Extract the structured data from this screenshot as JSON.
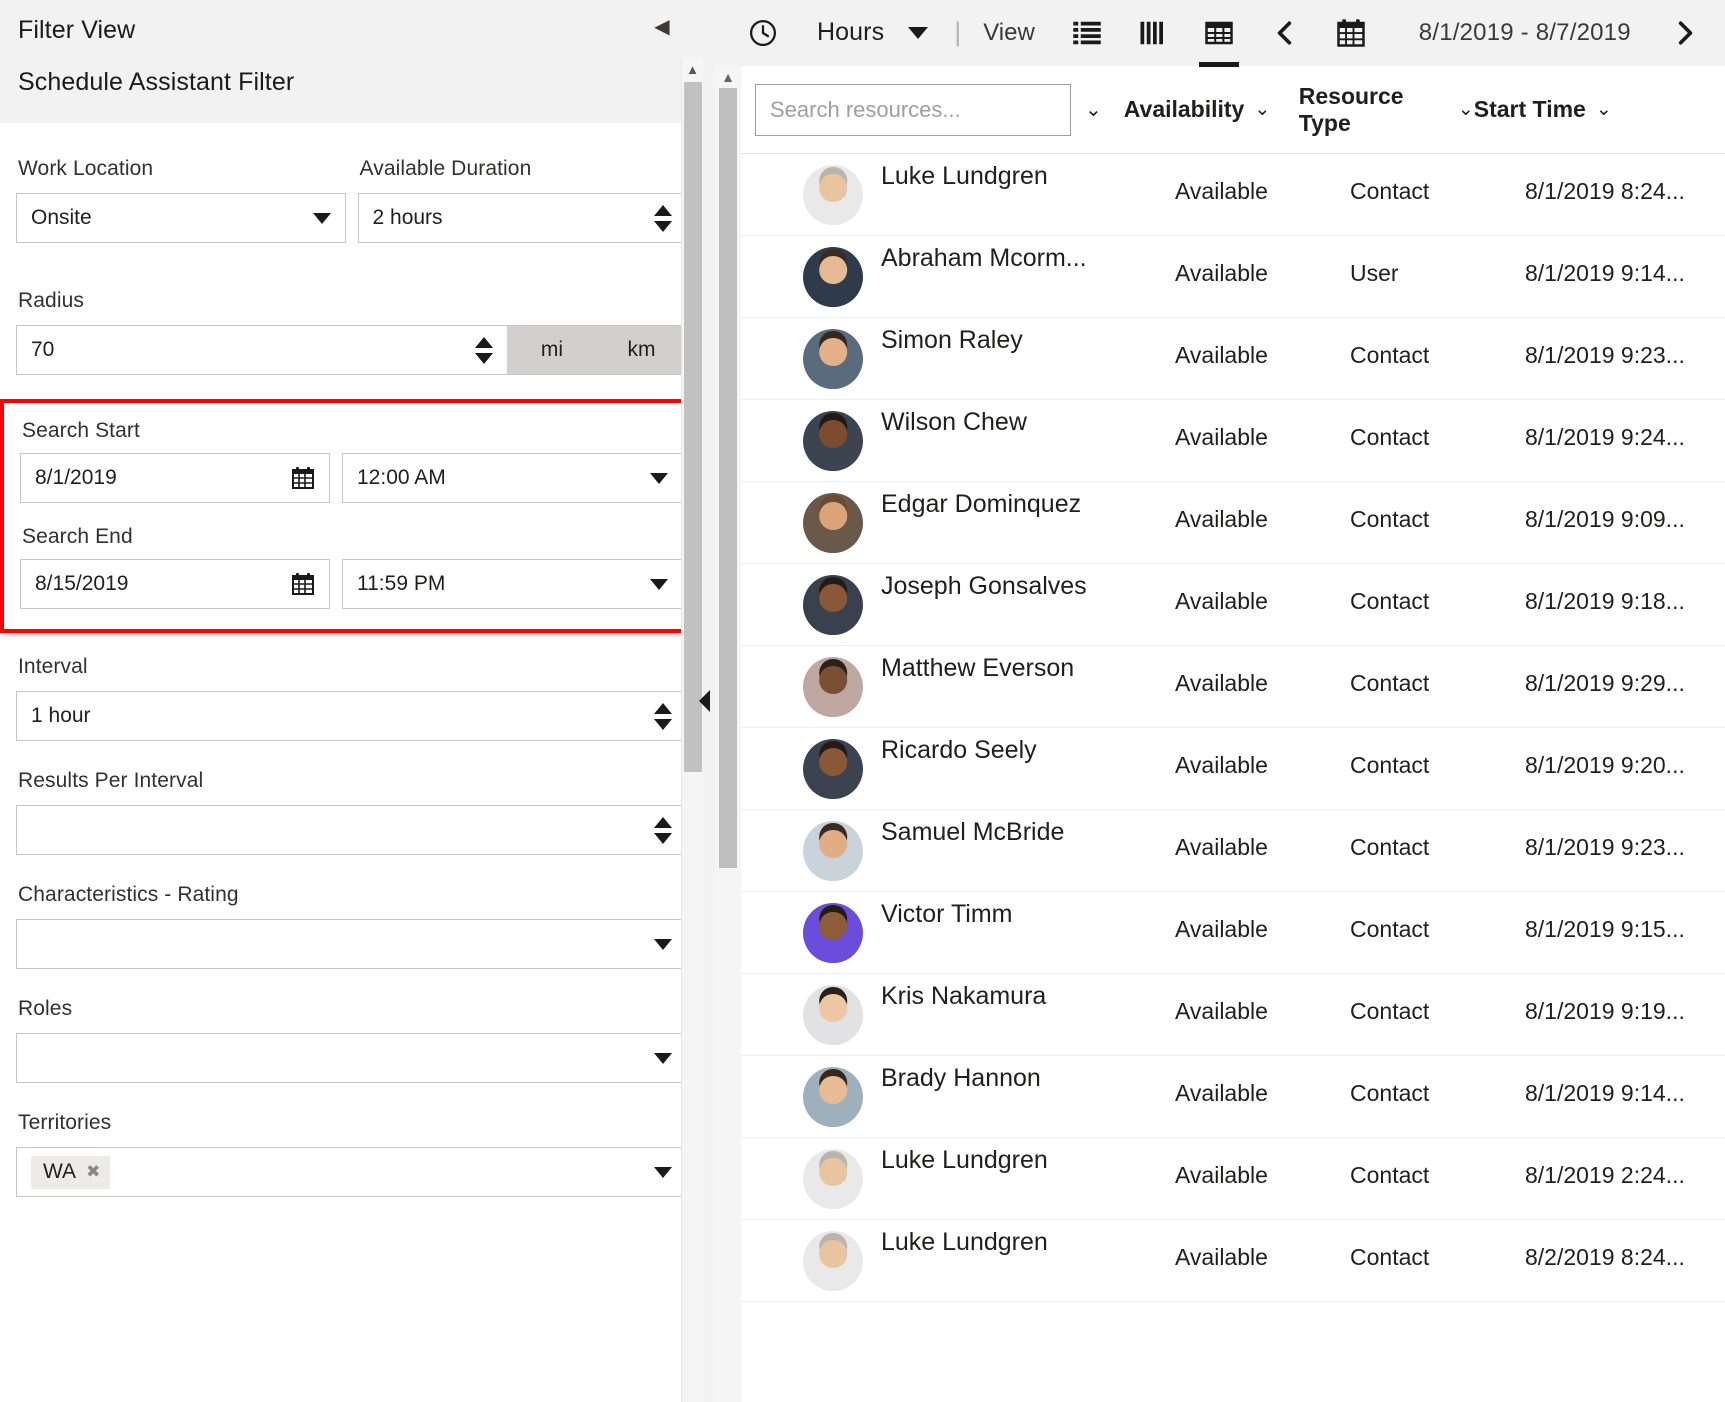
{
  "left_panel": {
    "title": "Filter View",
    "subtitle": "Schedule Assistant Filter",
    "collapse_icon": "chevron-left-icon",
    "fields": {
      "work_location": {
        "label": "Work Location",
        "value": "Onsite"
      },
      "available_duration": {
        "label": "Available Duration",
        "value": "2 hours"
      },
      "radius": {
        "label": "Radius",
        "value": "70",
        "unit_mi": "mi",
        "unit_km": "km"
      },
      "search_start": {
        "label": "Search Start",
        "date": "8/1/2019",
        "time": "12:00 AM"
      },
      "search_end": {
        "label": "Search End",
        "date": "8/15/2019",
        "time": "11:59 PM"
      },
      "interval": {
        "label": "Interval",
        "value": "1 hour"
      },
      "results_per_interval": {
        "label": "Results Per Interval",
        "value": ""
      },
      "characteristics_rating": {
        "label": "Characteristics - Rating",
        "value": ""
      },
      "roles": {
        "label": "Roles",
        "value": ""
      },
      "territories": {
        "label": "Territories",
        "tags": [
          "WA"
        ]
      }
    },
    "highlight_color": "#ff0000"
  },
  "right_panel": {
    "toolbar": {
      "clock_icon": "clock-icon",
      "unit_label": "Hours",
      "unit_caret_icon": "chevron-down-icon",
      "separator": "|",
      "view_label": "View",
      "icons": [
        {
          "name": "list-view-icon",
          "active": false
        },
        {
          "name": "column-view-icon",
          "active": false
        },
        {
          "name": "grid-view-icon",
          "active": true
        }
      ],
      "prev_icon": "chevron-left-icon",
      "calendar_icon": "calendar-icon",
      "date_range": "8/1/2019 - 8/7/2019",
      "next_icon": "chevron-right-icon"
    },
    "grid": {
      "search_placeholder": "Search resources...",
      "search_value": "",
      "search_chevron_icon": "chevron-down-icon",
      "columns": [
        {
          "label": "Availability",
          "sort_icon": "chevron-down-icon"
        },
        {
          "label": "Resource Type",
          "sort_icon": "chevron-down-icon"
        },
        {
          "label": "Start Time",
          "sort_icon": "chevron-down-icon"
        }
      ],
      "rows": [
        {
          "name": "Luke Lundgren",
          "availability": "Available",
          "resource_type": "Contact",
          "start_time": "8/1/2019 8:24...",
          "skin": "#e8c4a0",
          "hair": "#b9b5ad",
          "shirt": "#e9e9ea"
        },
        {
          "name": "Abraham Mcorm...",
          "availability": "Available",
          "resource_type": "User",
          "start_time": "8/1/2019 9:14...",
          "skin": "#e6b894",
          "hair": "#3a2b20",
          "shirt": "#2f3a4a"
        },
        {
          "name": "Simon Raley",
          "availability": "Available",
          "resource_type": "Contact",
          "start_time": "8/1/2019 9:23...",
          "skin": "#e3b089",
          "hair": "#33281e",
          "shirt": "#5a6b7d"
        },
        {
          "name": "Wilson Chew",
          "availability": "Available",
          "resource_type": "Contact",
          "start_time": "8/1/2019 9:24...",
          "skin": "#7b4c2e",
          "hair": "#221a14",
          "shirt": "#3b4450"
        },
        {
          "name": "Edgar Dominquez",
          "availability": "Available",
          "resource_type": "Contact",
          "start_time": "8/1/2019 9:09...",
          "skin": "#d9a478",
          "hair": "#6b4a33",
          "shirt": "#6a5848"
        },
        {
          "name": "Joseph Gonsalves",
          "availability": "Available",
          "resource_type": "Contact",
          "start_time": "8/1/2019 9:18...",
          "skin": "#8a5836",
          "hair": "#231b15",
          "shirt": "#39414d"
        },
        {
          "name": "Matthew Everson",
          "availability": "Available",
          "resource_type": "Contact",
          "start_time": "8/1/2019 9:29...",
          "skin": "#7a5034",
          "hair": "#2a2119",
          "shirt": "#c0a8a2"
        },
        {
          "name": "Ricardo Seely",
          "availability": "Available",
          "resource_type": "Contact",
          "start_time": "8/1/2019 9:20...",
          "skin": "#8a5837",
          "hair": "#231b15",
          "shirt": "#3a434f"
        },
        {
          "name": "Samuel McBride",
          "availability": "Available",
          "resource_type": "Contact",
          "start_time": "8/1/2019 9:23...",
          "skin": "#dfae84",
          "hair": "#3a2b20",
          "shirt": "#c9d3dc"
        },
        {
          "name": "Victor Timm",
          "availability": "Available",
          "resource_type": "Contact",
          "start_time": "8/1/2019 9:15...",
          "skin": "#8d5c39",
          "hair": "#241c15",
          "shirt": "#6b4ddb"
        },
        {
          "name": "Kris Nakamura",
          "availability": "Available",
          "resource_type": "Contact",
          "start_time": "8/1/2019 9:19...",
          "skin": "#edc6a3",
          "hair": "#2a2018",
          "shirt": "#e2e2e4"
        },
        {
          "name": "Brady Hannon",
          "availability": "Available",
          "resource_type": "Contact",
          "start_time": "8/1/2019 9:14...",
          "skin": "#e7bb93",
          "hair": "#34281d",
          "shirt": "#9fb0bd"
        },
        {
          "name": "Luke Lundgren",
          "availability": "Available",
          "resource_type": "Contact",
          "start_time": "8/1/2019 2:24...",
          "skin": "#e8c4a0",
          "hair": "#b9b5ad",
          "shirt": "#e9e9ea"
        },
        {
          "name": "Luke Lundgren",
          "availability": "Available",
          "resource_type": "Contact",
          "start_time": "8/2/2019 8:24...",
          "skin": "#e8c4a0",
          "hair": "#b9b5ad",
          "shirt": "#e9e9ea"
        }
      ]
    }
  }
}
